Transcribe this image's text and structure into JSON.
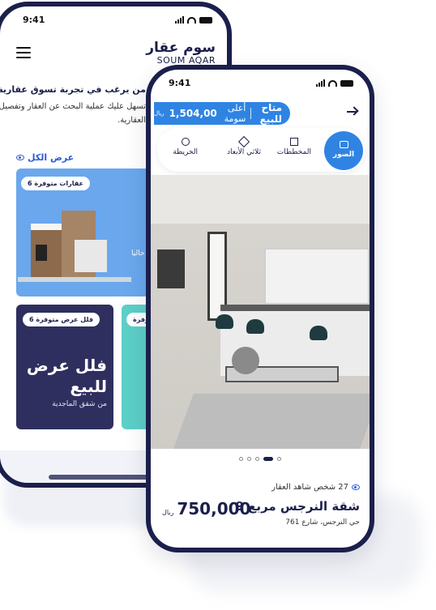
{
  "back_screen": {
    "time": "9:41",
    "logo_ar": "سوم عقار",
    "logo_en": "SOUM AQAR",
    "intro_title": "من يرغب في تجربة تسوق عقارية",
    "intro_text": "تسهل عليك عملية البحث عن العقار وتفصيل العروض العقارية.",
    "view_all": "عرض الكل",
    "card1_badge": "6 عقارات متوفرة",
    "card1_text": "حاليا",
    "card2_badge": "6 فلل عرض متوفرة",
    "card2_title": "فلل عرض للبيع",
    "card2_sub": "من شقق الماجدية",
    "card3_badge": "متوفرة"
  },
  "front_screen": {
    "time": "9:41",
    "price_pill_status": "متاح للبيع",
    "price_pill_highest": "أعلى سومة",
    "price_pill_amount": "1,504,00",
    "price_pill_currency": "ريال",
    "tabs": [
      {
        "label": "الصور",
        "icon": "camera-icon",
        "active": true
      },
      {
        "label": "المخططات",
        "icon": "plan-icon",
        "active": false
      },
      {
        "label": "ثلاثي الأبعاد",
        "icon": "cube-icon",
        "active": false
      },
      {
        "label": "الخريطة",
        "icon": "map-pin-icon",
        "active": false
      }
    ],
    "carousel_total": 5,
    "carousel_current": 4,
    "viewers": "27 شخص شاهد العقار",
    "title": "شقة النرجس مربع 9",
    "address": "حي النرجس، شارع 761",
    "price": "750,000",
    "currency": "ريال"
  },
  "colors": {
    "navy": "#1b1f4b",
    "accent_blue": "#2f84e3",
    "card_blue": "#6aa7ec",
    "card_navy": "#2e2f5e",
    "card_teal": "#5ccfc7"
  }
}
